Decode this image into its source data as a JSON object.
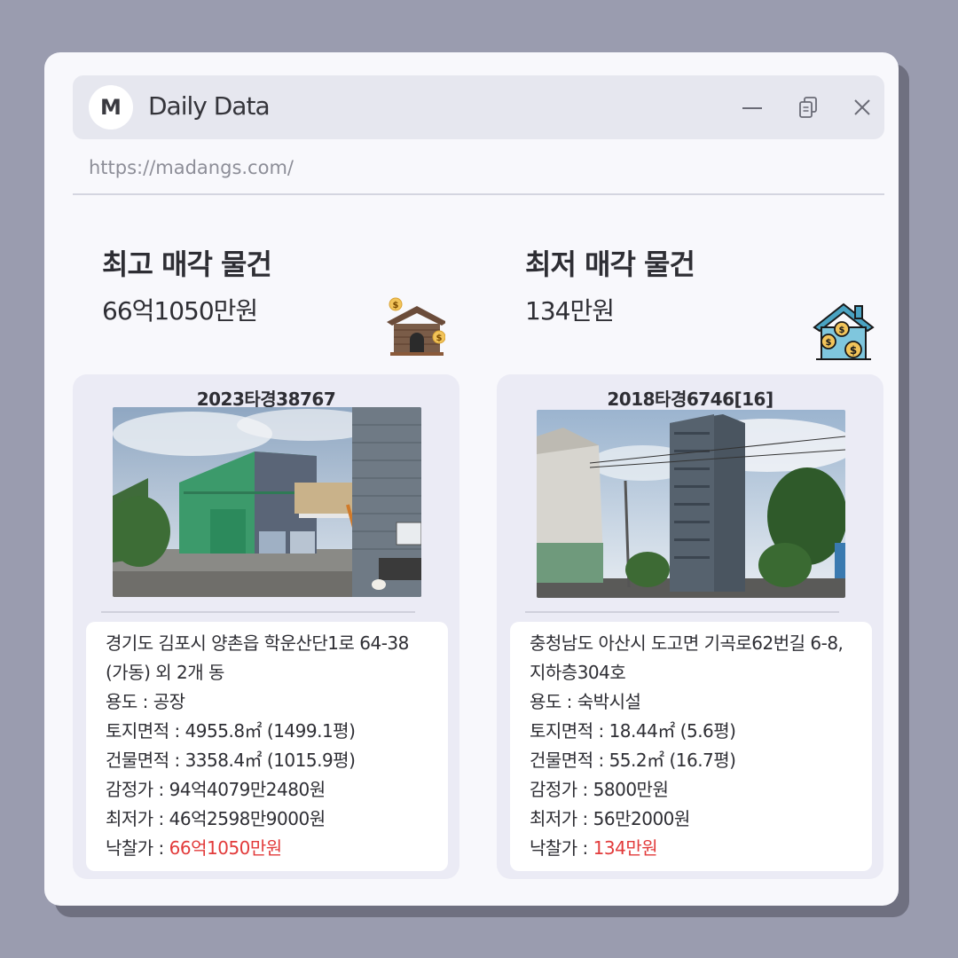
{
  "app": {
    "logo_letter": "M",
    "title": "Daily Data",
    "url": "https://madangs.com/"
  },
  "icons": {
    "minimize": "minimize-icon",
    "copy": "copy-icon",
    "close": "close-icon"
  },
  "highest": {
    "heading": "최고 매각 물건",
    "price": "66억1050만원",
    "case_no": "2023타경38767",
    "address": "경기도 김포시 양촌읍 학운산단1로 64-38 (가동) 외 2개 동",
    "usage_label": "용도 : ",
    "usage": "공장",
    "land_label": "토지면적 : ",
    "land": "4955.8㎡ (1499.1평)",
    "building_label": "건물면적 : ",
    "building": "3358.4㎡ (1015.9평)",
    "appraisal_label": "감정가 : ",
    "appraisal": "94억4079만2480원",
    "minimum_label": "최저가 : ",
    "minimum": "46억2598만9000원",
    "winning_label": "낙찰가 : ",
    "winning": "66억1050만원"
  },
  "lowest": {
    "heading": "최저 매각 물건",
    "price": "134만원",
    "case_no": "2018타경6746[16]",
    "address": "충청남도 아산시 도고면 기곡로62번길 6-8, 지하층304호",
    "usage_label": "용도 : ",
    "usage": "숙박시설",
    "land_label": "토지면적 : ",
    "land": "18.44㎡ (5.6평)",
    "building_label": "건물면적 : ",
    "building": "55.2㎡ (16.7평)",
    "appraisal_label": "감정가 : ",
    "appraisal": "5800만원",
    "minimum_label": "최저가 : ",
    "minimum": "56만2000원",
    "winning_label": "낙찰가 : ",
    "winning": "134만원"
  },
  "colors": {
    "background": "#9a9caf",
    "window": "#f8f8fc",
    "card": "#ebebf5",
    "highlight": "#e23b3b"
  }
}
